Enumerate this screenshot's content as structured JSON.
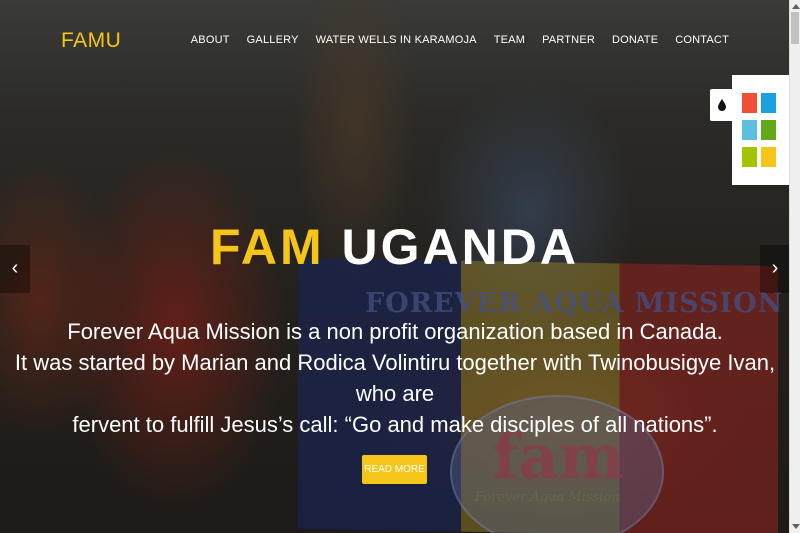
{
  "brand": {
    "logo_text": "FAMU",
    "accent_color": "#f5c518"
  },
  "nav": {
    "items": [
      {
        "label": "ABOUT"
      },
      {
        "label": "GALLERY"
      },
      {
        "label": "WATER WELLS IN KARAMOJA"
      },
      {
        "label": "TEAM"
      },
      {
        "label": "PARTNER"
      },
      {
        "label": "DONATE"
      },
      {
        "label": "CONTACT"
      }
    ]
  },
  "hero": {
    "title_part1": "FAM",
    "title_part2": "UGANDA",
    "desc_line1": "Forever Aqua Mission is a non profit organization based in Canada.",
    "desc_line2": "It was started by Marian and Rodica Volintiru together with Twinobusigye Ivan, who are",
    "desc_line3": "fervent to fulfill Jesus’s call: “Go and make disciples of all nations”.",
    "button_label": "READ MORE",
    "photo_banner_text": "FOREVER AQUA MISSION",
    "photo_logo_text": "fam",
    "photo_logo_sub": "Forever Aqua Mission"
  },
  "slider": {
    "prev_icon": "‹",
    "next_icon": "›"
  },
  "style_switcher": {
    "icon": "droplet-icon",
    "swatches": [
      "#f04e37",
      "#1ba1e2",
      "#5bc0de",
      "#60a917",
      "#a4c400",
      "#f5c518"
    ]
  }
}
